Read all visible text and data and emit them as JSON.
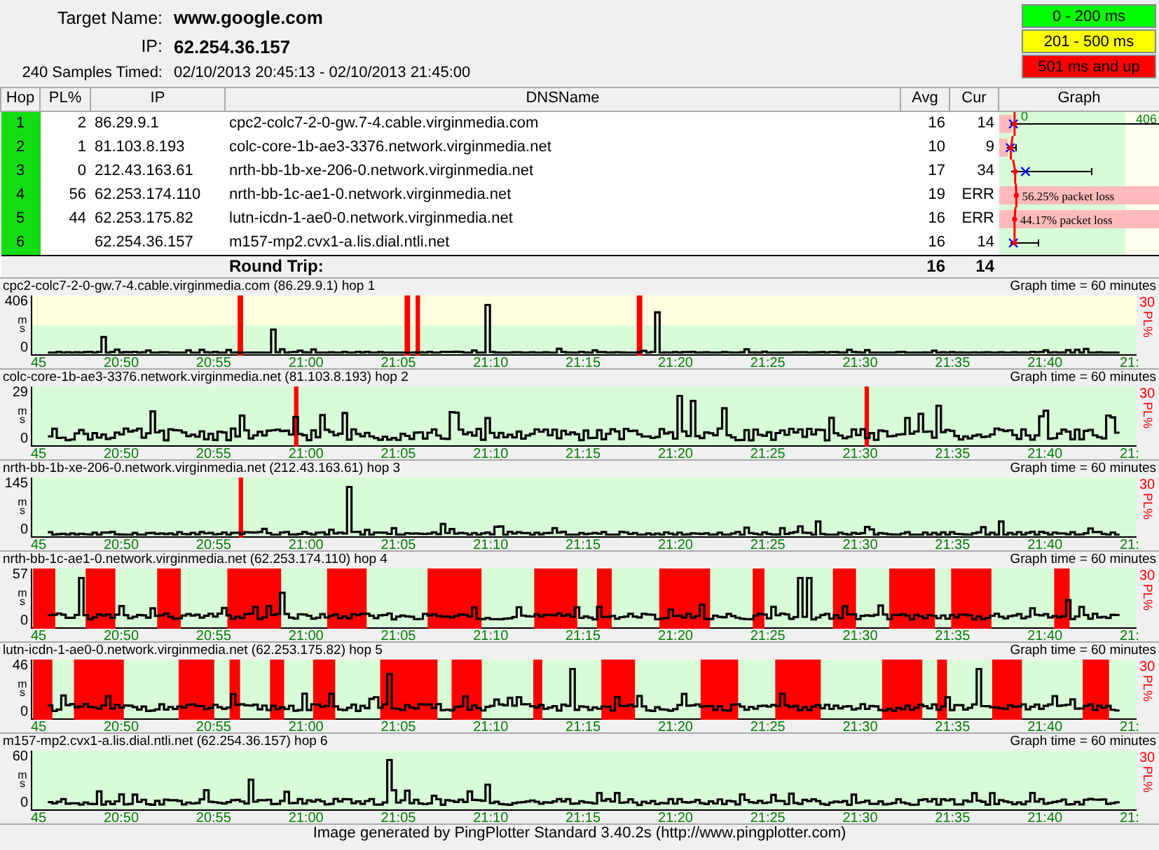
{
  "target": {
    "name_label": "Target Name:",
    "name": "www.google.com",
    "ip_label": "IP:",
    "ip": "62.254.36.157",
    "samples_label": "240 Samples Timed:",
    "samples_range": "02/10/2013 20:45:13 - 02/10/2013 21:45:00"
  },
  "legend": [
    {
      "label": "0 - 200 ms",
      "color": "#00ff00"
    },
    {
      "label": "201 - 500 ms",
      "color": "#ffff00"
    },
    {
      "label": "501 ms and up",
      "color": "#ff0000"
    }
  ],
  "table": {
    "columns": [
      "Hop",
      "PL%",
      "IP",
      "DNSName",
      "Avg",
      "Cur",
      "Graph"
    ],
    "graph_scale": {
      "min": "0",
      "max": "406"
    },
    "rows": [
      {
        "hop": "1",
        "pl": "2",
        "ip": "86.29.9.1",
        "dns": "cpc2-colc7-2-0-gw.7-4.cable.virginmedia.com",
        "avg": "16",
        "cur": "14"
      },
      {
        "hop": "2",
        "pl": "1",
        "ip": "81.103.8.193",
        "dns": "colc-core-1b-ae3-3376.network.virginmedia.net",
        "avg": "10",
        "cur": "9"
      },
      {
        "hop": "3",
        "pl": "0",
        "ip": "212.43.163.61",
        "dns": "nrth-bb-1b-xe-206-0.network.virginmedia.net",
        "avg": "17",
        "cur": "34"
      },
      {
        "hop": "4",
        "pl": "56",
        "ip": "62.253.174.110",
        "dns": "nrth-bb-1c-ae1-0.network.virginmedia.net",
        "avg": "19",
        "cur": "ERR",
        "loss_label": "56.25% packet loss"
      },
      {
        "hop": "5",
        "pl": "44",
        "ip": "62.253.175.82",
        "dns": "lutn-icdn-1-ae0-0.network.virginmedia.net",
        "avg": "16",
        "cur": "ERR",
        "loss_label": "44.17% packet loss"
      },
      {
        "hop": "6",
        "ip": "62.254.36.157",
        "dns": "m157-mp2.cvx1-a.lis.dial.ntli.net",
        "avg": "16",
        "cur": "14"
      }
    ],
    "round_trip": {
      "label": "Round Trip:",
      "avg": "16",
      "cur": "14"
    }
  },
  "graphs": [
    {
      "title": "cpc2-colc7-2-0-gw.7-4.cable.virginmedia.com (86.29.9.1) hop 1",
      "graph_time": "Graph time = 60 minutes",
      "kind": "two-band",
      "y_max": "406",
      "y_unit": "ms",
      "y_min": "0",
      "pl_max": "30",
      "pl_unit": "PL%",
      "x_labels": [
        "45",
        "20:50",
        "20:55",
        "21:00",
        "21:05",
        "21:10",
        "21:15",
        "21:20",
        "21:25",
        "21:30",
        "21:35",
        "21:40",
        "21:"
      ]
    },
    {
      "title": "colc-core-1b-ae3-3376.network.virginmedia.net (81.103.8.193) hop 2",
      "graph_time": "Graph time = 60 minutes",
      "kind": "one-band",
      "y_max": "29",
      "y_unit": "ms",
      "y_min": "0",
      "pl_max": "30",
      "pl_unit": "PL%",
      "x_labels": [
        "45",
        "20:50",
        "20:55",
        "21:00",
        "21:05",
        "21:10",
        "21:15",
        "21:20",
        "21:25",
        "21:30",
        "21:35",
        "21:40",
        "21:"
      ]
    },
    {
      "title": "nrth-bb-1b-xe-206-0.network.virginmedia.net (212.43.163.61) hop 3",
      "graph_time": "Graph time = 60 minutes",
      "kind": "one-band",
      "y_max": "145",
      "y_unit": "ms",
      "y_min": "0",
      "pl_max": "30",
      "pl_unit": "PL%",
      "x_labels": [
        "45",
        "20:50",
        "20:55",
        "21:00",
        "21:05",
        "21:10",
        "21:15",
        "21:20",
        "21:25",
        "21:30",
        "21:35",
        "21:40",
        "21:"
      ]
    },
    {
      "title": "nrth-bb-1c-ae1-0.network.virginmedia.net (62.253.174.110) hop 4",
      "graph_time": "Graph time = 60 minutes",
      "kind": "one-band",
      "y_max": "57",
      "y_unit": "ms",
      "y_min": "0",
      "pl_max": "30",
      "pl_unit": "PL%",
      "x_labels": [
        "45",
        "20:50",
        "20:55",
        "21:00",
        "21:05",
        "21:10",
        "21:15",
        "21:20",
        "21:25",
        "21:30",
        "21:35",
        "21:40",
        "21:"
      ]
    },
    {
      "title": "lutn-icdn-1-ae0-0.network.virginmedia.net (62.253.175.82) hop 5",
      "graph_time": "Graph time = 60 minutes",
      "kind": "one-band",
      "y_max": "46",
      "y_unit": "ms",
      "y_min": "0",
      "pl_max": "30",
      "pl_unit": "PL%",
      "x_labels": [
        "45",
        "20:50",
        "20:55",
        "21:00",
        "21:05",
        "21:10",
        "21:15",
        "21:20",
        "21:25",
        "21:30",
        "21:35",
        "21:40",
        "21:"
      ]
    },
    {
      "title": "m157-mp2.cvx1-a.lis.dial.ntli.net (62.254.36.157) hop 6",
      "graph_time": "Graph time = 60 minutes",
      "kind": "one-band",
      "y_max": "60",
      "y_unit": "ms",
      "y_min": "0",
      "pl_max": "30",
      "pl_unit": "PL%",
      "x_labels": [
        "45",
        "20:50",
        "20:55",
        "21:00",
        "21:05",
        "21:10",
        "21:15",
        "21:20",
        "21:25",
        "21:30",
        "21:35",
        "21:40",
        "21:"
      ]
    }
  ],
  "footer": "Image generated by PingPlotter Standard 3.40.2s (http://www.pingplotter.com)"
}
